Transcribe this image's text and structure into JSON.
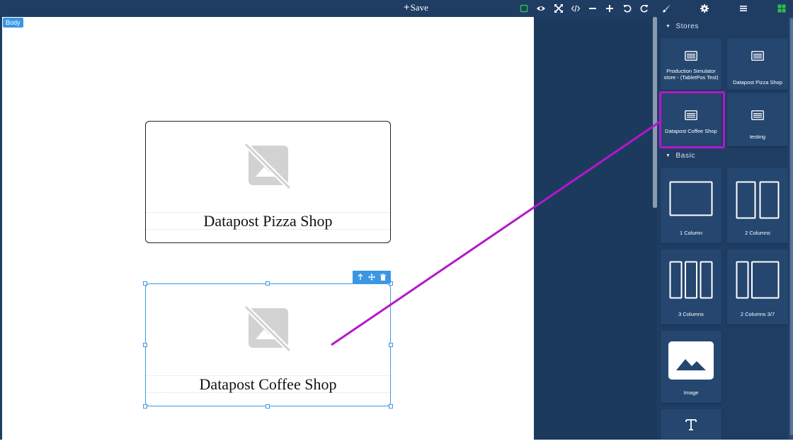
{
  "topbar": {
    "save_label": "Save",
    "icons": [
      "square-outline-icon",
      "eye-icon",
      "fullscreen-icon",
      "code-icon",
      "minus-icon",
      "plus-icon",
      "undo-icon",
      "redo-icon",
      "brush-icon",
      "gear-icon",
      "hamburger-icon",
      "blocks-icon"
    ],
    "accent": "#3b97e3",
    "active_green": "#2fbf4a"
  },
  "canvas": {
    "body_tag": "Body",
    "cards": [
      {
        "title": "Datapost Pizza Shop"
      },
      {
        "title": "Datapost Coffee Shop"
      }
    ]
  },
  "panel": {
    "stores_header": "Stores",
    "stores": [
      {
        "label": "Production Simulator store - (TabletPos Test)"
      },
      {
        "label": "Datapost Pizza Shop"
      },
      {
        "label": "Datapost Coffee Shop"
      },
      {
        "label": "testing"
      }
    ],
    "basic_header": "Basic",
    "basic": [
      {
        "label": "1 Column"
      },
      {
        "label": "2 Columns"
      },
      {
        "label": "3 Columns"
      },
      {
        "label": "2 Columns 3/7"
      },
      {
        "label": "Image"
      },
      {
        "label": ""
      }
    ]
  },
  "annotation": {
    "color": "#b318c9"
  }
}
